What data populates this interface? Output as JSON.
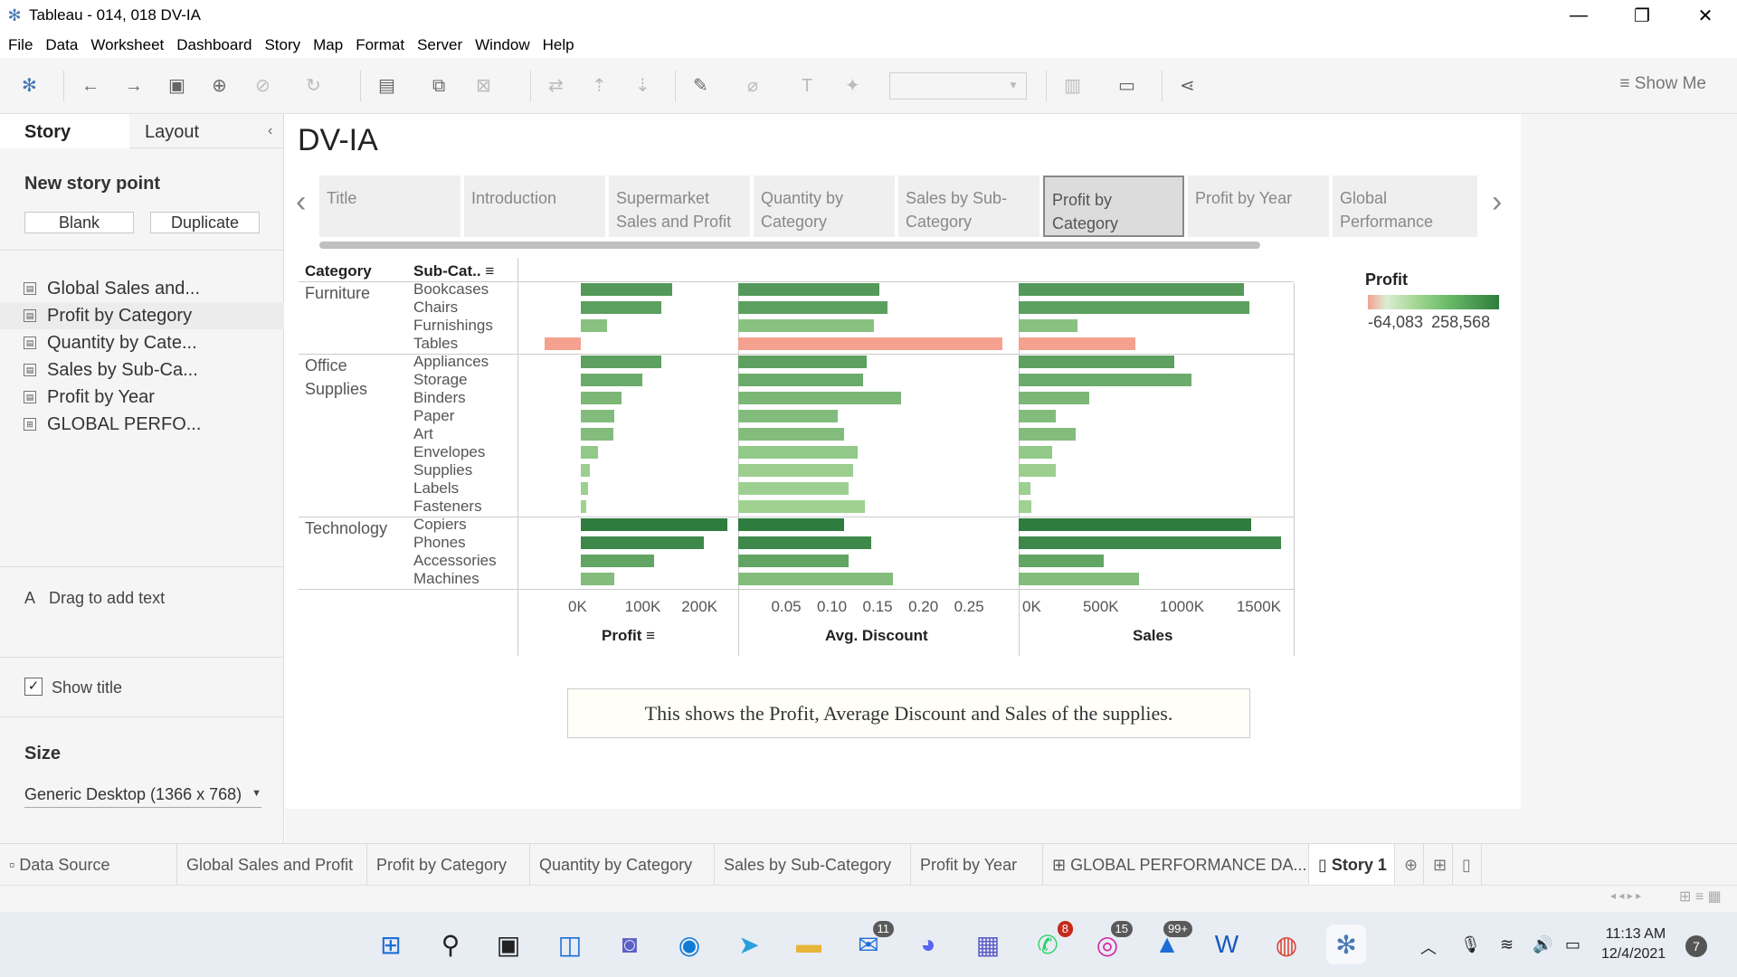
{
  "window": {
    "title": "Tableau - 014, 018 DV-IA"
  },
  "menu": [
    "File",
    "Data",
    "Worksheet",
    "Dashboard",
    "Story",
    "Map",
    "Format",
    "Server",
    "Window",
    "Help"
  ],
  "toolbar": {
    "show_me": "Show Me"
  },
  "left_pane": {
    "tabs": [
      "Story",
      "Layout"
    ],
    "new_story_point": "New story point",
    "blank_label": "Blank",
    "duplicate_label": "Duplicate",
    "sheets": [
      "Global Sales and...",
      "Profit by Category",
      "Quantity by Cate...",
      "Sales by Sub-Ca...",
      "Profit by Year",
      "GLOBAL PERFO..."
    ],
    "drag_text": "Drag to add text",
    "show_title": "Show title",
    "size_title": "Size",
    "size_value": "Generic Desktop (1366 x 768)"
  },
  "story": {
    "title": "DV-IA",
    "points": [
      {
        "line1": "Title",
        "line2": ""
      },
      {
        "line1": "Introduction",
        "line2": ""
      },
      {
        "line1": "Supermarket",
        "line2": "Sales and Profit"
      },
      {
        "line1": "Quantity by",
        "line2": "Category"
      },
      {
        "line1": "Sales by Sub-",
        "line2": "Category"
      },
      {
        "line1": "Profit by",
        "line2": "Category"
      },
      {
        "line1": "Profit by Year",
        "line2": ""
      },
      {
        "line1": "Global",
        "line2": "Performance"
      }
    ],
    "selected_point": 5,
    "caption": "This shows the Profit, Average Discount and Sales of the supplies."
  },
  "chart_data": {
    "type": "bar",
    "orientation": "horizontal",
    "headers": {
      "category": "Category",
      "subcategory": "Sub-Cat.."
    },
    "groups": [
      {
        "category": "Furniture",
        "subcategories": [
          "Bookcases",
          "Chairs",
          "Furnishings",
          "Tables"
        ]
      },
      {
        "category": "Office\nSupplies",
        "subcategories": [
          "Appliances",
          "Storage",
          "Binders",
          "Paper",
          "Art",
          "Envelopes",
          "Supplies",
          "Labels",
          "Fasteners"
        ]
      },
      {
        "category": "Technology",
        "subcategories": [
          "Copiers",
          "Phones",
          "Accessories",
          "Machines"
        ]
      }
    ],
    "series": [
      {
        "name": "Profit",
        "axis_ticks": [
          "0K",
          "100K",
          "200K"
        ],
        "xlim": [
          -64083,
          258568
        ],
        "values": [
          161924,
          141973,
          46968,
          -64083,
          141680,
          108008,
          72449,
          59208,
          57953,
          30400,
          15500,
          12900,
          10000,
          258568,
          216717,
          129627,
          58867
        ]
      },
      {
        "name": "Avg. Discount",
        "axis_ticks": [
          "0.05",
          "0.10",
          "0.15",
          "0.20",
          "0.25"
        ],
        "xlim": [
          0,
          0.29
        ],
        "values": [
          0.154,
          0.163,
          0.148,
          0.289,
          0.141,
          0.137,
          0.178,
          0.109,
          0.116,
          0.131,
          0.126,
          0.121,
          0.139,
          0.116,
          0.145,
          0.121,
          0.169
        ]
      },
      {
        "name": "Sales",
        "axis_ticks": [
          "0K",
          "500K",
          "1000K",
          "1500K"
        ],
        "xlim": [
          0,
          1700000
        ],
        "values": [
          1467000,
          1500000,
          384000,
          757000,
          1011000,
          1127000,
          461000,
          244000,
          372000,
          219000,
          242000,
          74000,
          84000,
          1510000,
          1707000,
          551000,
          780000
        ]
      }
    ],
    "color_by": "Profit",
    "legend": {
      "title": "Profit",
      "min": "-64,083",
      "max": "258,568",
      "low_color": "#f4a190",
      "high_color": "#2e7d3e"
    }
  },
  "sheet_tabs": [
    "Data Source",
    "Global Sales and Profit",
    "Profit by Category",
    "Quantity by Category",
    "Sales by Sub-Category",
    "Profit by Year",
    "GLOBAL PERFORMANCE DA...",
    "Story 1"
  ],
  "taskbar": {
    "badges": {
      "mail": "11",
      "whatsapp": "8",
      "instagram": "15",
      "other": "99+"
    },
    "time": "11:13 AM",
    "date": "12/4/2021",
    "notifications": "7"
  }
}
